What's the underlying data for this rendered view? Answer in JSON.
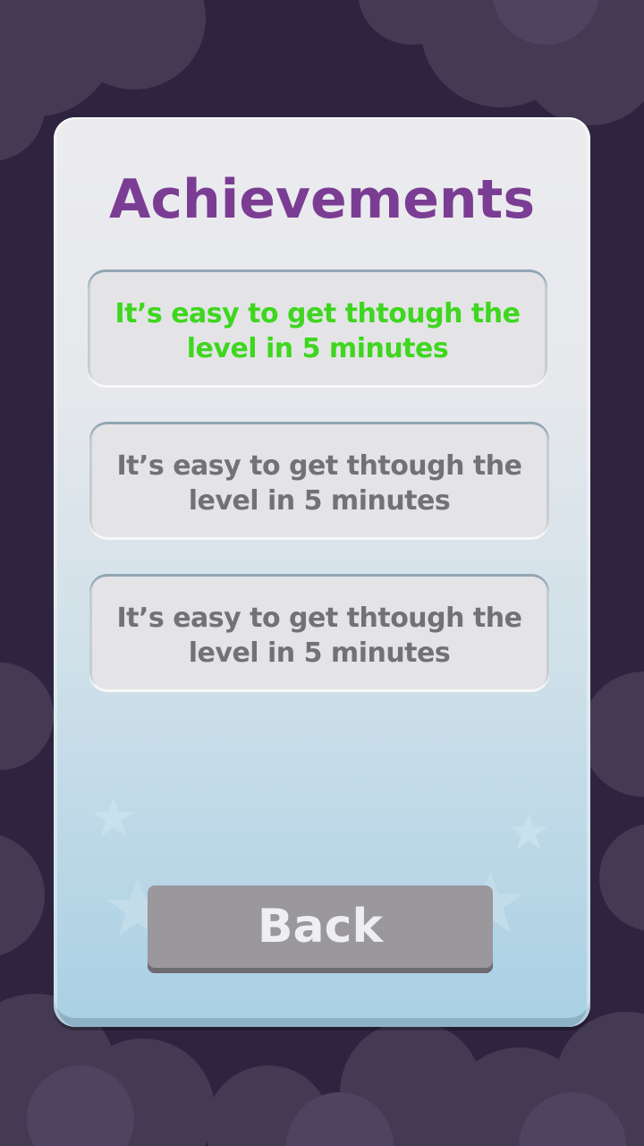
{
  "screen": {
    "title": "Achievements"
  },
  "achievements": [
    {
      "text": "It’s easy to get thtough the level in 5 minutes",
      "unlocked": true
    },
    {
      "text": "It’s easy to get thtough the level in 5 minutes",
      "unlocked": false
    },
    {
      "text": "It’s easy to get thtough the level in 5 minutes",
      "unlocked": false
    }
  ],
  "actions": {
    "back_label": "Back"
  },
  "colors": {
    "background": "#2f2440",
    "title": "#7b3d93",
    "unlocked_text": "#3fd61f",
    "locked_text": "#737177",
    "button": "#9a979d"
  },
  "icons": {
    "decoration": [
      "star-icon",
      "cloud-decoration"
    ]
  }
}
